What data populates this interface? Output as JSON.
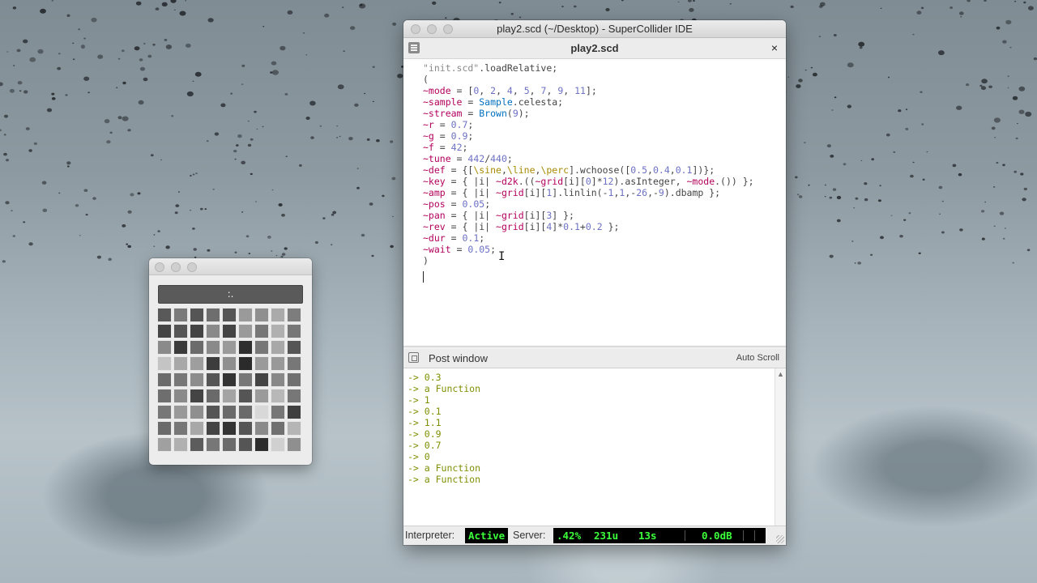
{
  "grid_window": {
    "button_label": ":.",
    "cells": [
      [
        "#595959",
        "#7a7a7a",
        "#555555",
        "#6e6e6e",
        "#555555",
        "#9a9a9a",
        "#8f8f8f",
        "#aaaaaa",
        "#7d7d7d"
      ],
      [
        "#444444",
        "#555555",
        "#444444",
        "#8a8a8a",
        "#444444",
        "#9a9a9a",
        "#777777",
        "#b0b0b0",
        "#777777"
      ],
      [
        "#8a8a8a",
        "#3a3a3a",
        "#6b6b6b",
        "#8a8a8a",
        "#9a9a9a",
        "#2e2e2e",
        "#777777",
        "#a8a8a8",
        "#555555"
      ],
      [
        "#c4c4c4",
        "#a8a8a8",
        "#9e9e9e",
        "#3d3d3d",
        "#8f8f8f",
        "#2b2b2b",
        "#9a9a9a",
        "#999999",
        "#777777"
      ],
      [
        "#6b6b6b",
        "#777777",
        "#8c8c8c",
        "#555555",
        "#333333",
        "#777777",
        "#444444",
        "#888888",
        "#707070"
      ],
      [
        "#6e6e6e",
        "#8a8a8a",
        "#444444",
        "#6a6a6a",
        "#a4a4a4",
        "#555555",
        "#9a9a9a",
        "#b8b8b8",
        "#777777"
      ],
      [
        "#777777",
        "#999999",
        "#8f8f8f",
        "#555555",
        "#6a6a6a",
        "#6a6a6a",
        "#d8d8d8",
        "#777777",
        "#3f3f3f"
      ],
      [
        "#6a6a6a",
        "#777777",
        "#a8a8a8",
        "#444444",
        "#333333",
        "#555555",
        "#8a8a8a",
        "#707070",
        "#b5b5b5"
      ],
      [
        "#a0a0a0",
        "#b0b0b0",
        "#5c5c5c",
        "#777777",
        "#6b6b6b",
        "#555555",
        "#2d2d2d",
        "#d0d0d0",
        "#8f8f8f"
      ]
    ]
  },
  "ide": {
    "window_title": "play2.scd (~/Desktop) - SuperCollider IDE",
    "doc_tab_title": "play2.scd",
    "close_symbol": "×",
    "code_lines": [
      [
        [
          "str",
          "\"init.scd\""
        ],
        [
          "plain",
          ".loadRelative;"
        ]
      ],
      [
        [
          "plain",
          "("
        ]
      ],
      [
        [
          "env",
          "~mode"
        ],
        [
          "plain",
          " = ["
        ],
        [
          "num",
          "0"
        ],
        [
          "plain",
          ", "
        ],
        [
          "num",
          "2"
        ],
        [
          "plain",
          ", "
        ],
        [
          "num",
          "4"
        ],
        [
          "plain",
          ", "
        ],
        [
          "num",
          "5"
        ],
        [
          "plain",
          ", "
        ],
        [
          "num",
          "7"
        ],
        [
          "plain",
          ", "
        ],
        [
          "num",
          "9"
        ],
        [
          "plain",
          ", "
        ],
        [
          "num",
          "11"
        ],
        [
          "plain",
          "];"
        ]
      ],
      [
        [
          "env",
          "~sample"
        ],
        [
          "plain",
          " = "
        ],
        [
          "cls",
          "Sample"
        ],
        [
          "plain",
          ".celesta;"
        ]
      ],
      [
        [
          "env",
          "~stream"
        ],
        [
          "plain",
          " = "
        ],
        [
          "cls",
          "Brown"
        ],
        [
          "plain",
          "("
        ],
        [
          "num",
          "9"
        ],
        [
          "plain",
          ");"
        ]
      ],
      [
        [
          "env",
          "~r"
        ],
        [
          "plain",
          " = "
        ],
        [
          "num",
          "0.7"
        ],
        [
          "plain",
          ";"
        ]
      ],
      [
        [
          "env",
          "~g"
        ],
        [
          "plain",
          " = "
        ],
        [
          "num",
          "0.9"
        ],
        [
          "plain",
          ";"
        ]
      ],
      [
        [
          "env",
          "~f"
        ],
        [
          "plain",
          " = "
        ],
        [
          "num",
          "42"
        ],
        [
          "plain",
          ";"
        ]
      ],
      [
        [
          "env",
          "~tune"
        ],
        [
          "plain",
          " = "
        ],
        [
          "num",
          "442"
        ],
        [
          "plain",
          "/"
        ],
        [
          "num",
          "440"
        ],
        [
          "plain",
          ";"
        ]
      ],
      [
        [
          "env",
          "~def"
        ],
        [
          "plain",
          " = {["
        ],
        [
          "sym",
          "\\sine"
        ],
        [
          "plain",
          ","
        ],
        [
          "sym",
          "\\line"
        ],
        [
          "plain",
          ","
        ],
        [
          "sym",
          "\\perc"
        ],
        [
          "plain",
          "].wchoose(["
        ],
        [
          "num",
          "0.5"
        ],
        [
          "plain",
          ","
        ],
        [
          "num",
          "0.4"
        ],
        [
          "plain",
          ","
        ],
        [
          "num",
          "0.1"
        ],
        [
          "plain",
          "])};"
        ]
      ],
      [
        [
          "env",
          "~key"
        ],
        [
          "plain",
          " = { |i| "
        ],
        [
          "env",
          "~d2k"
        ],
        [
          "plain",
          ".(("
        ],
        [
          "env",
          "~grid"
        ],
        [
          "plain",
          "[i]["
        ],
        [
          "num",
          "0"
        ],
        [
          "plain",
          "]*"
        ],
        [
          "num",
          "12"
        ],
        [
          "plain",
          ").asInteger, "
        ],
        [
          "env",
          "~mode"
        ],
        [
          "plain",
          ".()) };"
        ]
      ],
      [
        [
          "env",
          "~amp"
        ],
        [
          "plain",
          " = { |i| "
        ],
        [
          "env",
          "~grid"
        ],
        [
          "plain",
          "[i]["
        ],
        [
          "num",
          "1"
        ],
        [
          "plain",
          "].linlin(-"
        ],
        [
          "num",
          "1"
        ],
        [
          "plain",
          ","
        ],
        [
          "num",
          "1"
        ],
        [
          "plain",
          ",-"
        ],
        [
          "num",
          "26"
        ],
        [
          "plain",
          ",-"
        ],
        [
          "num",
          "9"
        ],
        [
          "plain",
          ").dbamp };"
        ]
      ],
      [
        [
          "env",
          "~pos"
        ],
        [
          "plain",
          " = "
        ],
        [
          "num",
          "0.05"
        ],
        [
          "plain",
          ";"
        ]
      ],
      [
        [
          "env",
          "~pan"
        ],
        [
          "plain",
          " = { |i| "
        ],
        [
          "env",
          "~grid"
        ],
        [
          "plain",
          "[i]["
        ],
        [
          "num",
          "3"
        ],
        [
          "plain",
          "] };"
        ]
      ],
      [
        [
          "env",
          "~rev"
        ],
        [
          "plain",
          " = { |i| "
        ],
        [
          "env",
          "~grid"
        ],
        [
          "plain",
          "[i]["
        ],
        [
          "num",
          "4"
        ],
        [
          "plain",
          "]*"
        ],
        [
          "num",
          "0.1"
        ],
        [
          "plain",
          "+"
        ],
        [
          "num",
          "0.2"
        ],
        [
          "plain",
          " };"
        ]
      ],
      [
        [
          "env",
          "~dur"
        ],
        [
          "plain",
          " = "
        ],
        [
          "num",
          "0.1"
        ],
        [
          "plain",
          ";"
        ]
      ],
      [
        [
          "env",
          "~wait"
        ],
        [
          "plain",
          " = "
        ],
        [
          "num",
          "0.05"
        ],
        [
          "plain",
          ";"
        ]
      ],
      [
        [
          "plain",
          ")"
        ]
      ]
    ],
    "post_window": {
      "title": "Post window",
      "auto_scroll_label": "Auto Scroll",
      "lines": [
        "-> 0.3",
        "-> a Function",
        "-> 1",
        "-> 0.1",
        "-> 1.1",
        "-> 0.9",
        "-> 0.7",
        "-> 0",
        "-> a Function",
        "-> a Function"
      ]
    },
    "status": {
      "interpreter_label": "Interpreter:",
      "interpreter_state": "Active",
      "server_label": "Server:",
      "cpu": ".42%",
      "ugens": "231u",
      "time": "13s",
      "volume": "0.0dB"
    }
  }
}
